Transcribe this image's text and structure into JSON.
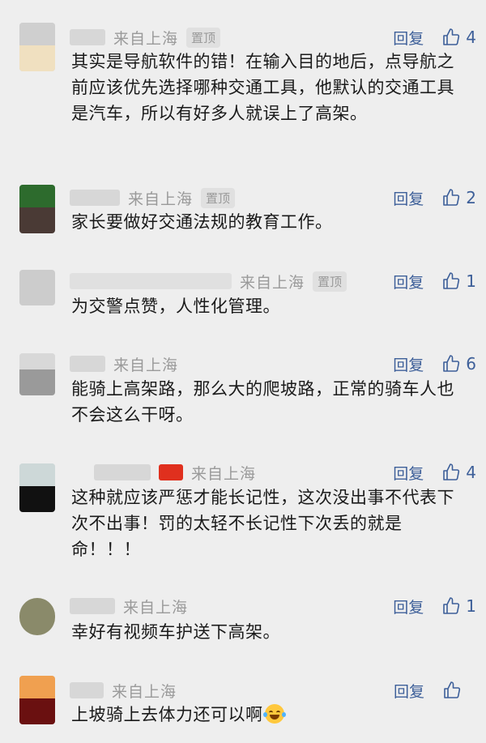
{
  "colors": {
    "background": "#eeeeee",
    "link": "#3d5f99",
    "meta": "#9a9a9a",
    "text": "#1a1a1a"
  },
  "comments": [
    {
      "location": "来自上海",
      "pinned": "置顶",
      "reply": "回复",
      "likes": "4",
      "text": "其实是导航软件的错！在输入目的地后，点导航之前应该优先选择哪种交通工具，他默认的交通工具是汽车，所以有好多人就误上了高架。"
    },
    {
      "location": "来自上海",
      "pinned": "置顶",
      "reply": "回复",
      "likes": "2",
      "text": "家长要做好交通法规的教育工作。"
    },
    {
      "location": "来自上海",
      "pinned": "置顶",
      "reply": "回复",
      "likes": "1",
      "text": "为交警点赞，人性化管理。"
    },
    {
      "location": "来自上海",
      "reply": "回复",
      "likes": "6",
      "text": "能骑上高架路，那么大的爬坡路，正常的骑车人也不会这么干呀。"
    },
    {
      "location": "来自上海",
      "reply": "回复",
      "likes": "4",
      "text": "这种就应该严惩才能长记性，这次没出事不代表下次不出事！罚的太轻不长记性下次丢的就是命！！！"
    },
    {
      "location": "来自上海",
      "reply": "回复",
      "likes": "1",
      "text": "幸好有视频车护送下高架。"
    },
    {
      "location": "来自上海",
      "reply": "回复",
      "likes": "",
      "text": "上坡骑上去体力还可以啊",
      "emoji": "laughing-tears-emoji"
    }
  ]
}
